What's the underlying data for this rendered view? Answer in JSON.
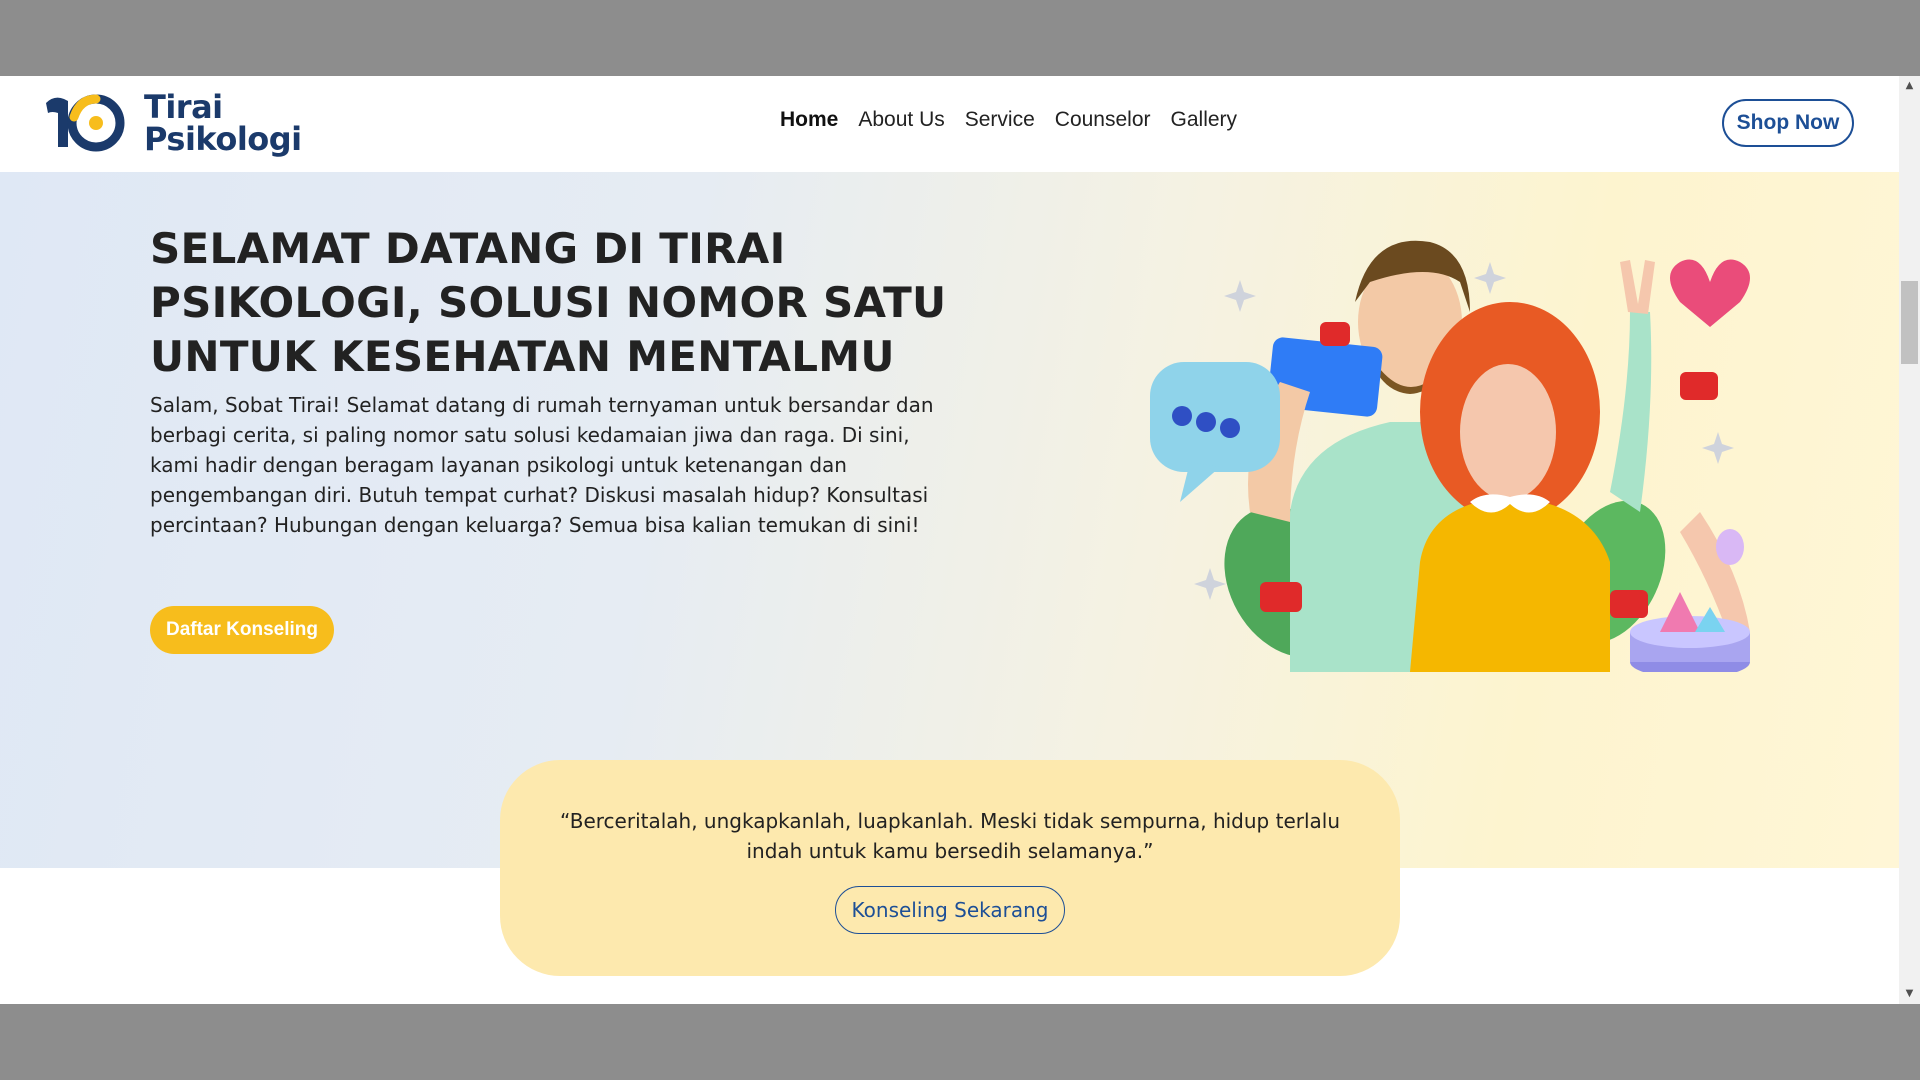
{
  "brand": {
    "name_line1": "Tirai",
    "name_line2": "Psikologi"
  },
  "nav": {
    "items": [
      {
        "label": "Home",
        "active": true
      },
      {
        "label": "About Us",
        "active": false
      },
      {
        "label": "Service",
        "active": false
      },
      {
        "label": "Counselor",
        "active": false
      },
      {
        "label": "Gallery",
        "active": false
      }
    ],
    "cta_label": "Shop Now"
  },
  "hero": {
    "title": "SELAMAT DATANG DI TIRAI PSIKOLOGI, SOLUSI NOMOR SATU UNTUK KESEHATAN MENTALMU",
    "description": "Salam, Sobat Tirai! Selamat datang di rumah ternyaman untuk bersandar dan berbagi cerita, si paling nomor satu solusi kedamaian jiwa dan raga. Di sini, kami hadir dengan beragam layanan psikologi untuk ketenangan dan pengembangan diri. Butuh tempat curhat? Diskusi masalah hidup? Konsultasi percintaan? Hubungan dengan keluarga? Semua bisa kalian temukan di sini!",
    "cta_label": "Daftar Konseling"
  },
  "quote": {
    "text": "“Berceritalah, ungkapkanlah, luapkanlah. Meski tidak sempurna, hidup terlalu indah untuk kamu bersedih selamanya.”",
    "cta_label": "Konseling Sekarang"
  },
  "colors": {
    "brand_blue": "#1d4f96",
    "brand_yellow": "#f7bd1c",
    "quote_bg": "#fde9ae"
  },
  "icons": {
    "scroll_up": "triangle-up-icon",
    "scroll_down": "triangle-down-icon"
  }
}
